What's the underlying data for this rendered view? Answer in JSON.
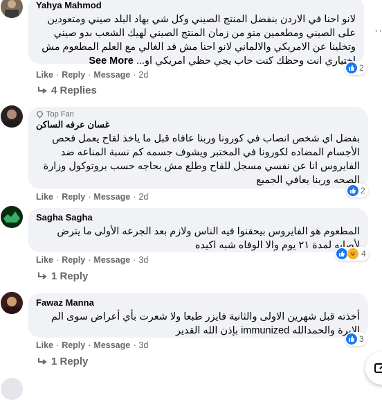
{
  "comments": [
    {
      "author": "Yahya Mahmod",
      "text": "لانو احنا في الاردن بنفضل المنتج الصيني وكل شي بهاد البلد صيني ومتعودين على الصيني ومطعمين منو من زمان المنتج الصيني لهيك الشعب بدو صيني وتخلينا عن الامريكي والالماني لانو احنا مش قد الغالي مع العلم المطعوم مش اختياري انت وحظك كنت حاب يجي حظي امريكي او...",
      "see_more": "See More",
      "actions": {
        "like": "Like",
        "reply": "Reply",
        "message": "Message",
        "time": "2d"
      },
      "reaction_count": "2",
      "replies": "4 Replies"
    },
    {
      "badge": "Top Fan",
      "author": "غسان عرفه الساكن",
      "text": "بفضل اي شخص انصاب في كورونا وربنا عافاه قبل ما ياخذ لقاح يعمل فحص الأجسام المضاده لكورونا في المختبر ويشوف جسمه كم نسبة المناعه ضد الفايروس انا عن نفسي مسجل للقاح وطلع مش بحاجه حسب بروتوكول وزارة الصحه وربنا يعافي الجميع",
      "actions": {
        "like": "Like",
        "reply": "Reply",
        "message": "Message",
        "time": "2d"
      },
      "reaction_count": "2"
    },
    {
      "author": "Sagha Sagha",
      "text": "المطعوم هو الفايروس بيحقنوا فيه الناس ولازم بعد الجرعه الأولى ما يترض لأصابه لمدة ٢١ يوم والا الوفاه شبه اكيده",
      "actions": {
        "like": "Like",
        "reply": "Reply",
        "message": "Message",
        "time": "3d"
      },
      "reaction_count": "4",
      "replies": "1 Reply"
    },
    {
      "author": "Fawaz Manna",
      "text": "أخذته قبل شهرين الاولى والثانية فايزر طبعا ولا شعرت بأي أعراض سوى الم الابرة والحمدالله immunized بإذن الله القدير",
      "actions": {
        "like": "Like",
        "reply": "Reply",
        "message": "Message",
        "time": "3d"
      },
      "reaction_count": "3",
      "replies": "1 Reply"
    }
  ],
  "colors": {
    "like_blue": "#1877f2",
    "bubble": "#f0f2f5",
    "meta": "#65676b",
    "haha": "#f7b125"
  }
}
